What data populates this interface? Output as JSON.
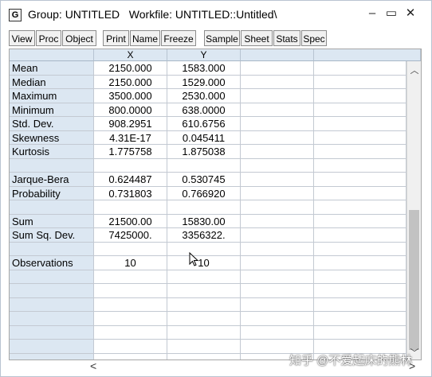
{
  "title_bar": {
    "icon_letter": "G",
    "title": "Group: UNTITLED   Workfile: UNTITLED::Untitled\\",
    "minimize": "–",
    "restore": "▭",
    "close": "✕"
  },
  "toolbar": {
    "buttons": [
      "View",
      "Proc",
      "Object",
      "Print",
      "Name",
      "Freeze",
      "Sample",
      "Sheet",
      "Stats",
      "Spec"
    ]
  },
  "grid": {
    "columns": [
      "",
      "X",
      "Y",
      "",
      ""
    ],
    "rows": [
      [
        "Mean",
        "2150.000",
        "1583.000"
      ],
      [
        "Median",
        "2150.000",
        "1529.000"
      ],
      [
        "Maximum",
        "3500.000",
        "2530.000"
      ],
      [
        "Minimum",
        "800.0000",
        "638.0000"
      ],
      [
        "Std. Dev.",
        "908.2951",
        "610.6756"
      ],
      [
        "Skewness",
        "4.31E-17",
        "0.045411"
      ],
      [
        "Kurtosis",
        "1.775758",
        "1.875038"
      ],
      [
        "",
        "",
        ""
      ],
      [
        "Jarque-Bera",
        "0.624487",
        "0.530745"
      ],
      [
        "Probability",
        "0.731803",
        "0.766920"
      ],
      [
        "",
        "",
        ""
      ],
      [
        "Sum",
        "21500.00",
        "15830.00"
      ],
      [
        "Sum Sq. Dev.",
        "7425000.",
        "3356322."
      ],
      [
        "",
        "",
        ""
      ],
      [
        "Observations",
        "10",
        "10"
      ],
      [
        "",
        "",
        ""
      ],
      [
        "",
        "",
        ""
      ],
      [
        "",
        "",
        ""
      ],
      [
        "",
        "",
        ""
      ],
      [
        "",
        "",
        ""
      ],
      [
        "",
        "",
        ""
      ],
      [
        "",
        "",
        ""
      ]
    ]
  },
  "scrollbar": {
    "up_arrow": "︿",
    "down_arrow": "﹀",
    "left_arrow": "<",
    "right_arrow": ">"
  },
  "watermark": "知乎 @不爱起床的熊林"
}
